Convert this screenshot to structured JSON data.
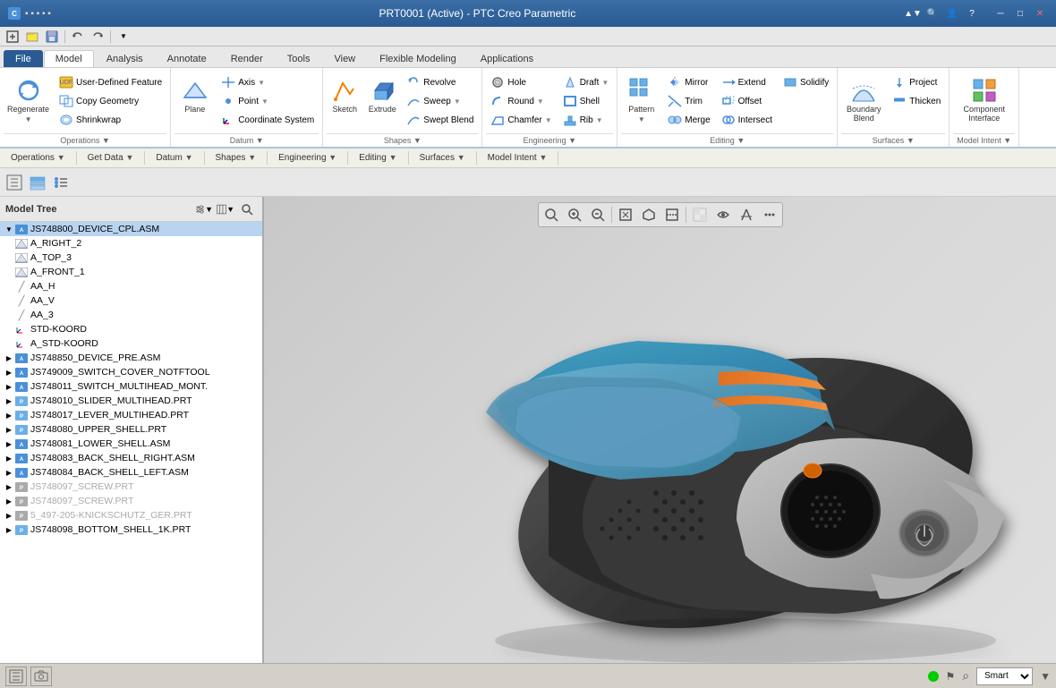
{
  "titleBar": {
    "title": "PRT0001 (Active) - PTC Creo Parametric",
    "minLabel": "─",
    "maxLabel": "□",
    "closeLabel": "✕"
  },
  "quickAccess": {
    "buttons": [
      "□",
      "📄",
      "💾",
      "↩",
      "↪",
      "✂",
      "◫",
      "✎",
      "▼"
    ]
  },
  "ribbonTabs": [
    {
      "label": "File",
      "active": false
    },
    {
      "label": "Model",
      "active": true
    },
    {
      "label": "Analysis",
      "active": false
    },
    {
      "label": "Annotate",
      "active": false
    },
    {
      "label": "Render",
      "active": false
    },
    {
      "label": "Tools",
      "active": false
    },
    {
      "label": "View",
      "active": false
    },
    {
      "label": "Flexible Modeling",
      "active": false
    },
    {
      "label": "Applications",
      "active": false
    }
  ],
  "ribbonGroups": [
    {
      "id": "operations",
      "items": [
        {
          "label": "Regenerate",
          "icon": "⟳",
          "type": "large"
        },
        {
          "label": "User-Defined Feature",
          "icon": "★"
        },
        {
          "label": "Copy Geometry",
          "icon": "⊡"
        },
        {
          "label": "Shrinkwrap",
          "icon": "◈"
        }
      ]
    },
    {
      "id": "datum",
      "items": [
        {
          "label": "Plane",
          "icon": "◱"
        },
        {
          "label": "Axis",
          "icon": "╋"
        },
        {
          "label": "Point",
          "icon": "•"
        },
        {
          "label": "Coordinate System",
          "icon": "⊕"
        }
      ]
    },
    {
      "id": "shapes",
      "items": [
        {
          "label": "Sketch",
          "icon": "✏"
        },
        {
          "label": "Extrude",
          "icon": "⬛"
        },
        {
          "label": "Revolve",
          "icon": "↻"
        },
        {
          "label": "Sweep",
          "icon": "↗"
        },
        {
          "label": "Swept Blend",
          "icon": "⇗"
        }
      ]
    },
    {
      "id": "engineering",
      "items": [
        {
          "label": "Hole",
          "icon": "○"
        },
        {
          "label": "Round",
          "icon": "◌"
        },
        {
          "label": "Chamfer",
          "icon": "◇"
        },
        {
          "label": "Draft",
          "icon": "⬔"
        },
        {
          "label": "Shell",
          "icon": "◻"
        },
        {
          "label": "Rib",
          "icon": "▬"
        }
      ]
    },
    {
      "id": "editing",
      "items": [
        {
          "label": "Pattern",
          "icon": "⊞"
        },
        {
          "label": "Mirror",
          "icon": "⧿"
        },
        {
          "label": "Trim",
          "icon": "✂"
        },
        {
          "label": "Merge",
          "icon": "⊕"
        },
        {
          "label": "Extend",
          "icon": "↔"
        },
        {
          "label": "Offset",
          "icon": "⊟"
        },
        {
          "label": "Intersect",
          "icon": "∩"
        },
        {
          "label": "Solidify",
          "icon": "■"
        }
      ]
    },
    {
      "id": "surfaces",
      "items": [
        {
          "label": "Boundary Blend",
          "icon": "⬡"
        },
        {
          "label": "Project",
          "icon": "⇩"
        },
        {
          "label": "Thicken",
          "icon": "⬜"
        }
      ]
    },
    {
      "id": "modelIntent",
      "items": [
        {
          "label": "Component Interface",
          "icon": "⊞"
        }
      ]
    }
  ],
  "sectionLabels": [
    {
      "label": "Operations",
      "arrow": "▼"
    },
    {
      "label": "Get Data",
      "arrow": "▼"
    },
    {
      "label": "Datum",
      "arrow": "▼"
    },
    {
      "label": "Shapes",
      "arrow": "▼"
    },
    {
      "label": "Engineering",
      "arrow": "▼"
    },
    {
      "label": "Editing",
      "arrow": "▼"
    },
    {
      "label": "Surfaces",
      "arrow": "▼"
    },
    {
      "label": "Model Intent",
      "arrow": "▼"
    }
  ],
  "toolbar2": {
    "buttons": [
      "⊞",
      "⊡",
      "✲"
    ]
  },
  "viewportToolbar": {
    "buttons": [
      "🔍",
      "🔍+",
      "🔍-",
      "□",
      "◱",
      "⊡",
      "▦",
      "✂",
      "⊞",
      "⊟"
    ]
  },
  "modelTree": {
    "title": "Model Tree",
    "items": [
      {
        "id": "root",
        "label": "JS748800_DEVICE_CPL.ASM",
        "level": 0,
        "type": "asm",
        "expanded": true,
        "isRoot": true
      },
      {
        "id": "a_right",
        "label": "A_RIGHT_2",
        "level": 1,
        "type": "plane"
      },
      {
        "id": "a_top",
        "label": "A_TOP_3",
        "level": 1,
        "type": "plane"
      },
      {
        "id": "a_front",
        "label": "A_FRONT_1",
        "level": 1,
        "type": "plane"
      },
      {
        "id": "aa_h",
        "label": "AA_H",
        "level": 1,
        "type": "axis"
      },
      {
        "id": "aa_v",
        "label": "AA_V",
        "level": 1,
        "type": "axis"
      },
      {
        "id": "aa_3",
        "label": "AA_3",
        "level": 1,
        "type": "axis"
      },
      {
        "id": "std_koord",
        "label": "STD-KOORD",
        "level": 1,
        "type": "coord"
      },
      {
        "id": "a_std_koord",
        "label": "A_STD-KOORD",
        "level": 1,
        "type": "coord"
      },
      {
        "id": "dev_pre",
        "label": "JS748850_DEVICE_PRE.ASM",
        "level": 1,
        "type": "asm",
        "hasArrow": true
      },
      {
        "id": "switch_cover",
        "label": "JS749009_SWITCH_COVER_NOTFTOOL",
        "level": 1,
        "type": "asm",
        "hasArrow": true
      },
      {
        "id": "switch_multi",
        "label": "JS748011_SWITCH_MULTIHEAD_MONT.",
        "level": 1,
        "type": "asm",
        "hasArrow": true
      },
      {
        "id": "slider",
        "label": "JS748010_SLIDER_MULTIHEAD.PRT",
        "level": 1,
        "type": "prt",
        "hasArrow": true
      },
      {
        "id": "lever",
        "label": "JS748017_LEVER_MULTIHEAD.PRT",
        "level": 1,
        "type": "prt",
        "hasArrow": true
      },
      {
        "id": "upper_shell",
        "label": "JS748080_UPPER_SHELL.PRT",
        "level": 1,
        "type": "prt",
        "hasArrow": true
      },
      {
        "id": "lower_shell",
        "label": "JS748081_LOWER_SHELL.ASM",
        "level": 1,
        "type": "asm",
        "hasArrow": true
      },
      {
        "id": "back_right",
        "label": "JS748083_BACK_SHELL_RIGHT.ASM",
        "level": 1,
        "type": "asm",
        "hasArrow": true
      },
      {
        "id": "back_left",
        "label": "JS748084_BACK_SHELL_LEFT.ASM",
        "level": 1,
        "type": "asm",
        "hasArrow": true
      },
      {
        "id": "screw1",
        "label": "JS748097_SCREW.PRT",
        "level": 1,
        "type": "prt",
        "dimmed": true,
        "hasArrow": true
      },
      {
        "id": "screw2",
        "label": "JS748097_SCREW.PRT",
        "level": 1,
        "type": "prt",
        "dimmed": true,
        "hasArrow": true
      },
      {
        "id": "knickschutz",
        "label": "5_497-205-KNICKSCHUTZ_GER.PRT",
        "level": 1,
        "type": "prt",
        "dimmed": true,
        "hasArrow": true
      },
      {
        "id": "bottom_shell",
        "label": "JS748098_BOTTOM_SHELL_1K.PRT",
        "level": 1,
        "type": "prt",
        "hasArrow": true
      }
    ]
  },
  "statusBar": {
    "smartLabel": "Smart",
    "statusDotColor": "#00cc00",
    "binocularsIcon": "🔭"
  }
}
